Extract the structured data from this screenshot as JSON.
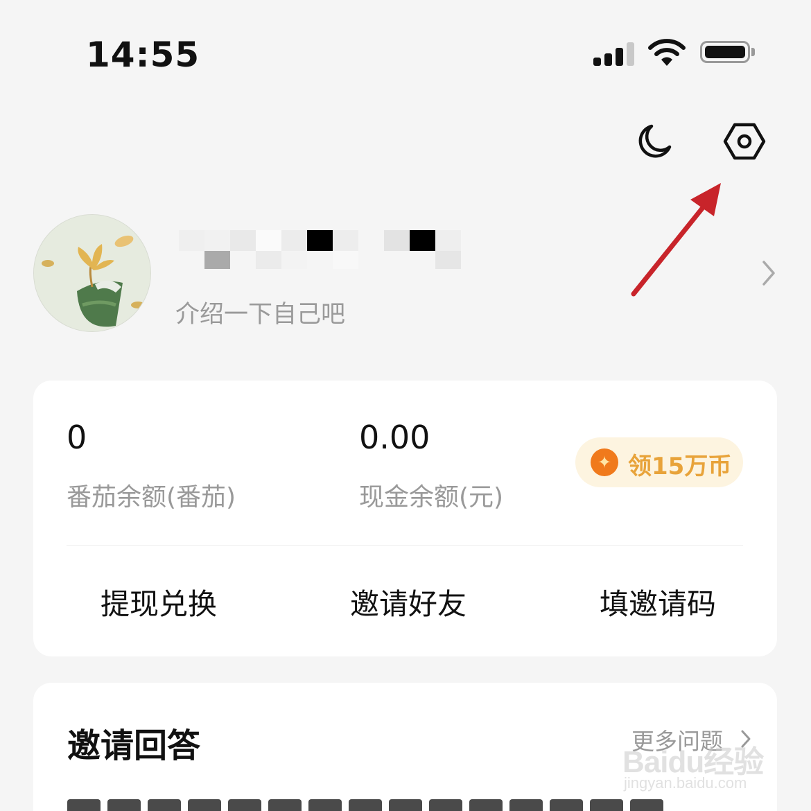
{
  "status_bar": {
    "time": "14:55",
    "icons": [
      "cellular-signal-icon",
      "wifi-icon",
      "battery-icon"
    ]
  },
  "top_actions": {
    "icons": [
      "moon-icon",
      "settings-hexagon-icon"
    ]
  },
  "profile": {
    "bio": "介绍一下自己吧"
  },
  "wallet": {
    "tomato_balance_value": "0",
    "tomato_balance_label": "番茄余额(番茄)",
    "cash_balance_value": "0.00",
    "cash_balance_label": "现金余额(元)",
    "coin_button_label": "领15万币",
    "actions": [
      "提现兑换",
      "邀请好友",
      "填邀请码"
    ]
  },
  "invite_answer": {
    "title": "邀请回答",
    "more_label": "更多问题"
  },
  "watermark": {
    "logo": "Baidu经验",
    "url": "jingyan.baidu.com"
  },
  "colors": {
    "background": "#f5f5f5",
    "card": "#ffffff",
    "coin_accent": "#e8a33a",
    "coin_icon": "#f07a1c",
    "annotation_arrow": "#c8242a"
  }
}
